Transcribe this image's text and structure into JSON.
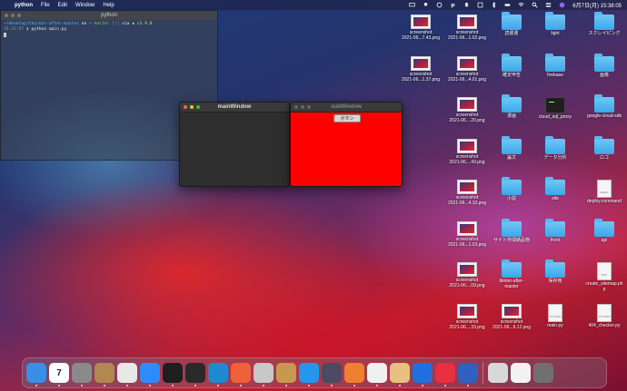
{
  "menubar": {
    "app_name": "python",
    "items": [
      "File",
      "Edit",
      "Window",
      "Help"
    ],
    "clock": "6月7日(月) 15:38:05"
  },
  "terminal": {
    "title": "python",
    "prompt_path": "~/desktop/tkinter-after-master",
    "prompt_on": "on",
    "branch": "master",
    "status": "[!]",
    "via": "via",
    "python_version": "v3.9.0",
    "time": "15:37:57",
    "command": "python main.py"
  },
  "main_window": {
    "title": "mainWindow"
  },
  "sub_window": {
    "title": "subWindow",
    "button_label": "ボタン"
  },
  "desktop": {
    "columns": [
      [
        {
          "label": "screenshot\n2021-06...7.43.png",
          "kind": "shot"
        },
        {
          "label": "screenshot\n2021-06...1.37.png",
          "kind": "shot"
        }
      ],
      [
        {
          "label": "screenshot\n2021-06...1.02.png",
          "kind": "shot"
        },
        {
          "label": "screenshot\n2021-06...4.01.png",
          "kind": "shot"
        },
        {
          "label": "screenshot\n2021-06....20.png",
          "kind": "shot"
        },
        {
          "label": "screenshot\n2021-06....43.png",
          "kind": "shot"
        },
        {
          "label": "screenshot\n2021-06...4.10.png",
          "kind": "shot"
        },
        {
          "label": "screenshot\n2021-06...1.03.png",
          "kind": "shot"
        },
        {
          "label": "screenshot\n2021-06....09.png",
          "kind": "shot"
        },
        {
          "label": "screenshot\n2021-06....33.png",
          "kind": "shot"
        }
      ],
      [
        {
          "label": "読書書",
          "kind": "folder"
        },
        {
          "label": "確定申告",
          "kind": "folder"
        },
        {
          "label": "漫画",
          "kind": "folder"
        },
        {
          "label": "論文",
          "kind": "folder"
        },
        {
          "label": "小説",
          "kind": "folder"
        },
        {
          "label": "サイト作成納品物",
          "kind": "folder"
        },
        {
          "label": "tkinter-after-\nmaster",
          "kind": "folder"
        },
        {
          "label": "screenshot\n2021-06...9.12.png",
          "kind": "shot"
        }
      ],
      [
        {
          "label": "light",
          "kind": "folder"
        },
        {
          "label": "firebase",
          "kind": "folder"
        },
        {
          "label": "cloud_sql_proxy",
          "kind": "term"
        },
        {
          "label": "データ分析",
          "kind": "folder"
        },
        {
          "label": "site",
          "kind": "folder"
        },
        {
          "label": "front",
          "kind": "folder"
        },
        {
          "label": "保存用",
          "kind": "folder"
        },
        {
          "label": "main.py",
          "kind": "doc",
          "badge": "PYTHON"
        }
      ],
      [
        {
          "label": "スクレイピング",
          "kind": "folder"
        },
        {
          "label": "画像",
          "kind": "folder"
        },
        {
          "label": "google-cloud-sdk",
          "kind": "folder"
        },
        {
          "label": "ロゴ",
          "kind": "folder"
        },
        {
          "label": "deploy.command",
          "kind": "doc",
          "badge": "SHELL"
        },
        {
          "label": "api",
          "kind": "folder"
        },
        {
          "label": "create_sitemap.ph\np",
          "kind": "doc",
          "badge": "PHP"
        },
        {
          "label": "404_checker.py",
          "kind": "doc",
          "badge": "PYTHON"
        }
      ]
    ]
  },
  "dock": {
    "calendar_day": "7",
    "apps": [
      {
        "name": "finder",
        "color": "#3a8ee6"
      },
      {
        "name": "calendar",
        "color": "#ffffff"
      },
      {
        "name": "system-preferences",
        "color": "#8a8a8a"
      },
      {
        "name": "script-editor",
        "color": "#b08850"
      },
      {
        "name": "chrome",
        "color": "#e8e8e8"
      },
      {
        "name": "zoom",
        "color": "#2d8cff"
      },
      {
        "name": "terminal",
        "color": "#1e1e1e"
      },
      {
        "name": "terminal-2",
        "color": "#2a2a2a"
      },
      {
        "name": "vscode",
        "color": "#1f8ad2"
      },
      {
        "name": "swift-playgrounds",
        "color": "#f0603a"
      },
      {
        "name": "sequel",
        "color": "#c8c8c8"
      },
      {
        "name": "archive-utility",
        "color": "#c89850"
      },
      {
        "name": "docker",
        "color": "#2496ed"
      },
      {
        "name": "quicktime",
        "color": "#4a4a60"
      },
      {
        "name": "sourcetree",
        "color": "#f08030"
      },
      {
        "name": "postgres-app",
        "color": "#f0f0f0"
      },
      {
        "name": "preview",
        "color": "#e8c080"
      },
      {
        "name": "infinity",
        "color": "#2070e0"
      },
      {
        "name": "timer",
        "color": "#e83040"
      },
      {
        "name": "grid-app",
        "color": "#3060c0"
      },
      {
        "name": "image-viewer",
        "color": "#d8d8d8"
      },
      {
        "name": "document",
        "color": "#f2f2f2"
      },
      {
        "name": "trash",
        "color": "#707070"
      }
    ]
  }
}
